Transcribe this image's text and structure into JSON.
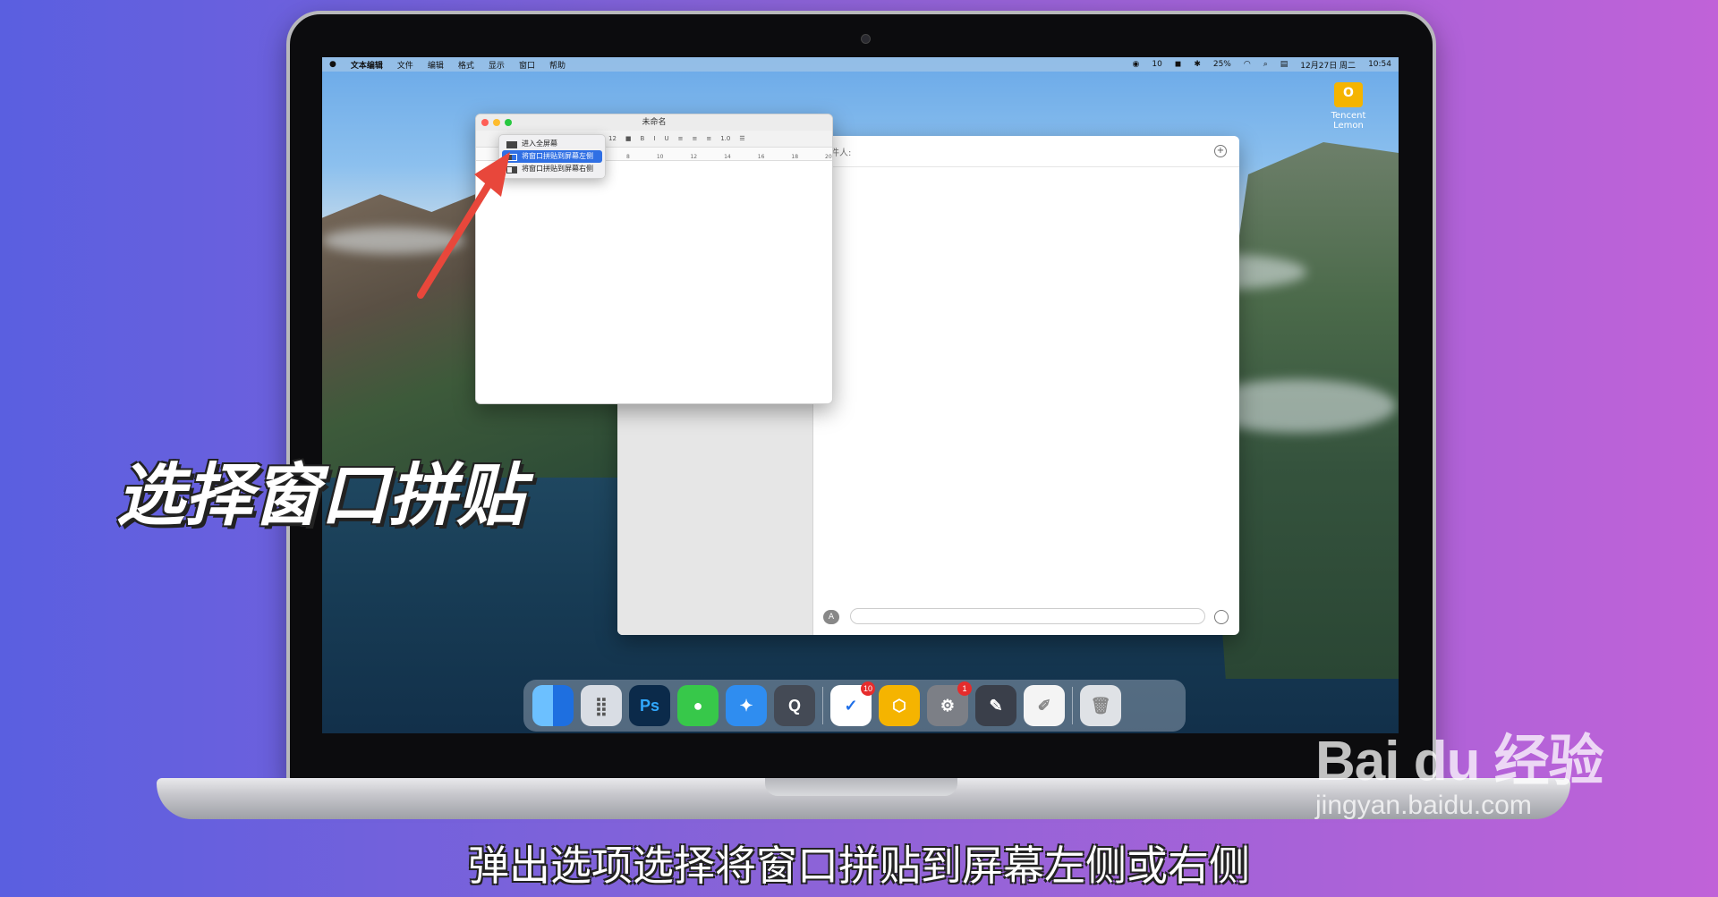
{
  "menubar": {
    "apple": "",
    "app_name": "文本编辑",
    "items": [
      "文件",
      "编辑",
      "格式",
      "显示",
      "窗口",
      "帮助"
    ],
    "status_items": [
      "10",
      "25%",
      "12月27日 周二",
      "10:54"
    ]
  },
  "desktop_icon": {
    "label": "Tencent Lemon"
  },
  "messages_window": {
    "to_label": "收件人:"
  },
  "textedit_window": {
    "title": "未命名",
    "toolbar": {
      "font_size": "12",
      "bold": "B",
      "italic": "I",
      "underline": "U",
      "spacing": "1.0"
    },
    "ruler_ticks": [
      "8",
      "10",
      "12",
      "14",
      "16",
      "18",
      "20"
    ]
  },
  "window_popup": {
    "items": [
      {
        "label": "进入全屏幕",
        "selected": false
      },
      {
        "label": "将窗口拼贴到屏幕左侧",
        "selected": true
      },
      {
        "label": "将窗口拼贴到屏幕右侧",
        "selected": false
      }
    ]
  },
  "dock": {
    "apps": [
      {
        "name": "finder",
        "color": "#2b8cf0",
        "text": ""
      },
      {
        "name": "launchpad",
        "color": "#d9dde4",
        "text": ""
      },
      {
        "name": "photoshop",
        "color": "#0b2a4a",
        "text": "Ps"
      },
      {
        "name": "messages",
        "color": "#37c84a",
        "text": ""
      },
      {
        "name": "safari",
        "color": "#2f8df0",
        "text": ""
      },
      {
        "name": "quicktime",
        "color": "#444a55",
        "text": ""
      },
      {
        "name": "dingtalk",
        "color": "#ffffff",
        "text": "",
        "badge": "10"
      },
      {
        "name": "tencent-lemon",
        "color": "#f5b400",
        "text": ""
      },
      {
        "name": "system-preferences",
        "color": "#7c7f86",
        "text": "",
        "badge": "1"
      },
      {
        "name": "xcode",
        "color": "#3a3f4a",
        "text": ""
      },
      {
        "name": "textedit",
        "color": "#f4f4f4",
        "text": ""
      },
      {
        "name": "trash",
        "color": "#dfe2e6",
        "text": ""
      }
    ]
  },
  "overlay": {
    "headline": "选择窗口拼贴",
    "subtitle": "弹出选项选择将窗口拼贴到屏幕左侧或右侧"
  },
  "watermark": {
    "brand": "Bai du 经验",
    "url": "jingyan.baidu.com"
  }
}
